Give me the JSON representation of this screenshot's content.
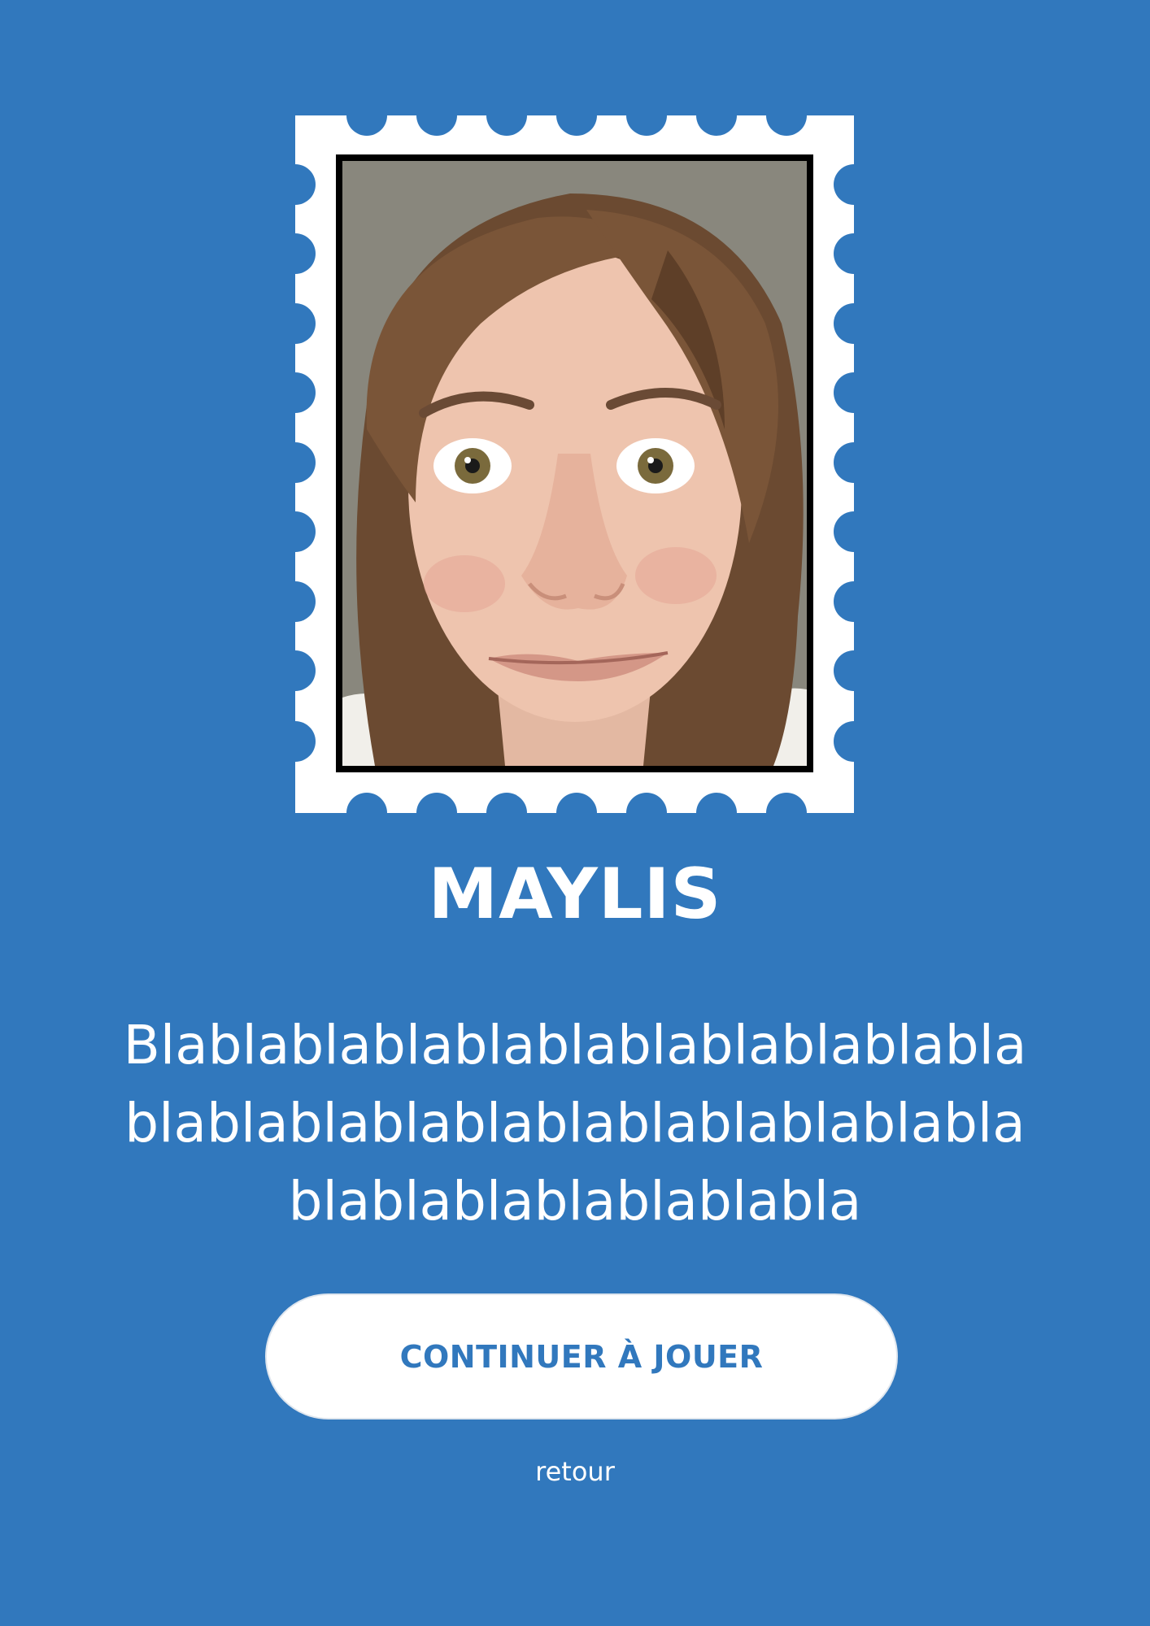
{
  "profile": {
    "photo_description": "portrait",
    "name": "MAYLIS",
    "description_lines": [
      "Blablablablablablablablablablabla",
      "blablablablablablablablablablabla",
      "blablablablablablabla"
    ]
  },
  "actions": {
    "continue_label": "CONTINUER À JOUER",
    "back_label": "retour"
  },
  "colors": {
    "background": "#3178bd",
    "accent": "#3178bd",
    "stamp": "#ffffff"
  }
}
